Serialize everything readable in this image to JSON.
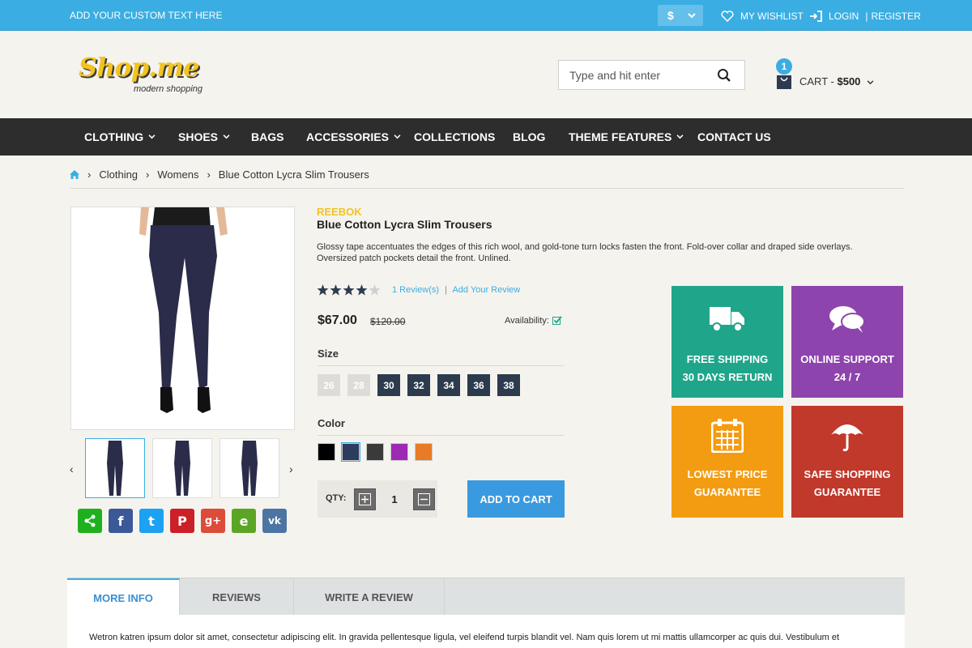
{
  "topbar": {
    "custom_text": "ADD YOUR CUSTOM TEXT HERE",
    "currency": "$",
    "wishlist": "MY WISHLIST",
    "login": "LOGIN",
    "divider": "|",
    "register": "REGISTER"
  },
  "header": {
    "logo_brand": "Shop.me",
    "logo_tagline": "modern shopping",
    "search_placeholder": "Type and hit enter",
    "cart_count": "1",
    "cart_label": "CART -",
    "cart_total": "$500"
  },
  "nav": {
    "items": [
      {
        "label": "CLOTHING",
        "dropdown": true
      },
      {
        "label": "SHOES",
        "dropdown": true
      },
      {
        "label": "BAGS",
        "dropdown": false
      },
      {
        "label": "ACCESSORIES",
        "dropdown": true
      },
      {
        "label": "COLLECTIONS",
        "dropdown": false
      },
      {
        "label": "BLOG",
        "dropdown": false
      },
      {
        "label": "THEME FEATURES",
        "dropdown": true
      },
      {
        "label": "CONTACT US",
        "dropdown": false
      }
    ]
  },
  "breadcrumb": {
    "items": [
      "Clothing",
      "Womens",
      "Blue Cotton Lycra Slim Trousers"
    ]
  },
  "product": {
    "brand": "REEBOK",
    "title": "Blue Cotton Lycra Slim Trousers",
    "description": "Glossy tape accentuates the edges of this rich wool, and gold-tone turn locks fasten the front. Fold-over collar and draped side overlays. Oversized patch pockets detail the front. Unlined.",
    "rating": 4,
    "rating_max": 5,
    "reviews_link": "1 Review(s)",
    "review_sep": "|",
    "add_review_link": "Add Your Review",
    "price": "$67.00",
    "old_price": "$120.00",
    "availability_label": "Availability:",
    "size_label": "Size",
    "sizes": [
      {
        "value": "26",
        "available": false
      },
      {
        "value": "28",
        "available": false
      },
      {
        "value": "30",
        "available": true
      },
      {
        "value": "32",
        "available": true
      },
      {
        "value": "34",
        "available": true
      },
      {
        "value": "36",
        "available": true
      },
      {
        "value": "38",
        "available": true
      }
    ],
    "color_label": "Color",
    "colors": [
      "#000000",
      "#2d3b5c",
      "#3a3a3a",
      "#9b2bb4",
      "#e87b26"
    ],
    "selected_color": 1,
    "qty_label": "QTY:",
    "qty": "1",
    "add_to_cart": "ADD TO CART"
  },
  "features": [
    {
      "line1": "FREE SHIPPING",
      "line2": "30 DAYS RETURN",
      "color": "#1fa58a",
      "icon": "truck-icon"
    },
    {
      "line1": "ONLINE SUPPORT",
      "line2": "24 / 7",
      "color": "#8e44ad",
      "icon": "chat-icon"
    },
    {
      "line1": "LOWEST PRICE",
      "line2": "GUARANTEE",
      "color": "#f39c12",
      "icon": "calendar-icon"
    },
    {
      "line1": "SAFE SHOPPING",
      "line2": "GUARANTEE",
      "color": "#c0392b",
      "icon": "umbrella-icon"
    }
  ],
  "social": [
    {
      "name": "share-icon",
      "color": "#1fb01f",
      "glyph": "⋖"
    },
    {
      "name": "facebook-icon",
      "color": "#3b5998",
      "glyph": "f"
    },
    {
      "name": "twitter-icon",
      "color": "#1da1f2",
      "glyph": "t"
    },
    {
      "name": "pinterest-icon",
      "color": "#cb2027",
      "glyph": "P"
    },
    {
      "name": "google-plus-icon",
      "color": "#dd4b39",
      "glyph": "g+"
    },
    {
      "name": "evernote-icon",
      "color": "#5ba525",
      "glyph": "e"
    },
    {
      "name": "vk-icon",
      "color": "#4c75a3",
      "glyph": "vk"
    }
  ],
  "tabs": {
    "items": [
      "MORE INFO",
      "REVIEWS",
      "WRITE A REVIEW"
    ],
    "active": 0,
    "content": "Wetron katren ipsum dolor sit amet, consectetur adipiscing elit. In gravida pellentesque ligula, vel eleifend turpis blandit vel. Nam quis lorem ut mi mattis ullamcorper ac quis dui. Vestibulum et"
  }
}
